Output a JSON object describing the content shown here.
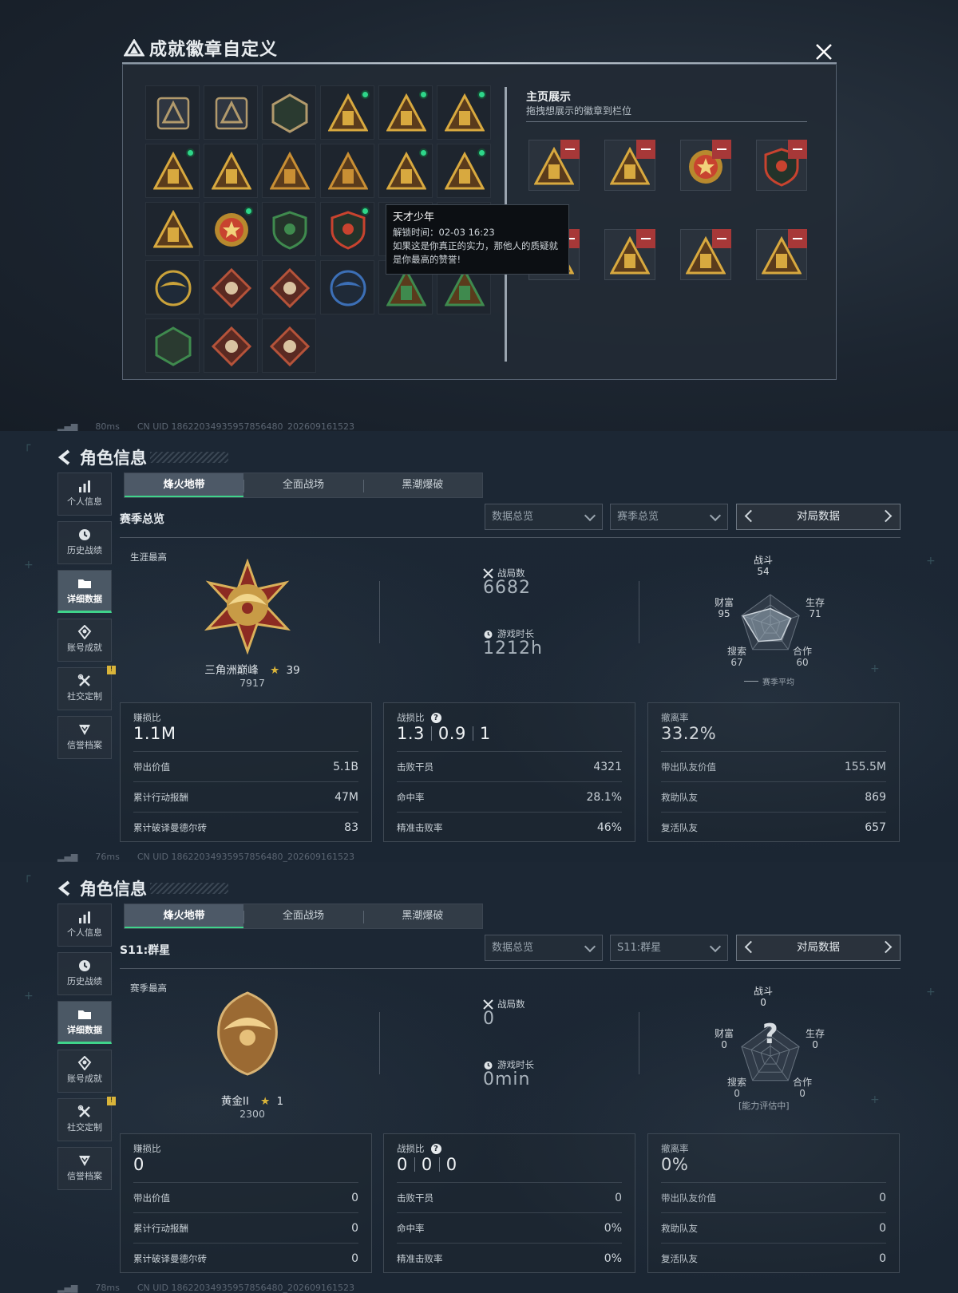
{
  "badge_modal": {
    "title": "成就徽章自定义",
    "showcase_title": "主页展示",
    "showcase_sub": "拖拽想展示的徽章到栏位",
    "tooltip": {
      "name": "天才少年",
      "unlock": "解锁时间：02-03 16:23",
      "desc1": "如果这是你真正的实力，那他人的质疑就",
      "desc2": "是你最高的赞誉!"
    },
    "badges": [
      {
        "icon": "triangle-emblem-icon",
        "color": "#b29a6c",
        "dot": false
      },
      {
        "icon": "helicopter-badge-icon",
        "color": "#b29a6c",
        "dot": false
      },
      {
        "icon": "hex-target-badge-icon",
        "color": "#b29a6c",
        "dot": false
      },
      {
        "icon": "tower-54-badge-icon",
        "color": "#d8a93f",
        "dot": true
      },
      {
        "icon": "figure-55-badge-icon",
        "color": "#d8a93f",
        "dot": true
      },
      {
        "icon": "shield-56-badge-icon",
        "color": "#d8a93f",
        "dot": true
      },
      {
        "icon": "lantern-badge-icon",
        "color": "#d8a93f",
        "dot": true
      },
      {
        "icon": "ship-badge-icon",
        "color": "#d8a93f",
        "dot": false
      },
      {
        "icon": "number-1-badge-icon",
        "color": "#c98f34",
        "dot": false
      },
      {
        "icon": "number-2-badge-icon",
        "color": "#c98f34",
        "dot": false
      },
      {
        "icon": "tower-badge-icon",
        "color": "#d8a93f",
        "dot": true
      },
      {
        "icon": "soldiers-badge-icon",
        "color": "#d8a93f",
        "dot": true
      },
      {
        "icon": "pyramid-badge-icon",
        "color": "#d8a93f",
        "dot": false
      },
      {
        "icon": "star-medal-icon",
        "color": "#c8432f",
        "dot": true
      },
      {
        "icon": "green-shield-badge-icon",
        "color": "#3f8a4e",
        "dot": false
      },
      {
        "icon": "crest-badge-icon",
        "color": "#c8432f",
        "dot": true
      },
      {
        "icon": "blue-wing-badge-icon",
        "color": "#3c6fb6",
        "dot": false
      },
      {
        "icon": "green-wing-badge-icon",
        "color": "#3f8a4e",
        "dot": false
      },
      {
        "icon": "gold-wing-badge-icon",
        "color": "#caa23a",
        "dot": false
      },
      {
        "icon": "wolf-badge-icon",
        "color": "#b5533a",
        "dot": false
      },
      {
        "icon": "wolf-red-badge-icon",
        "color": "#b5533a",
        "dot": false
      },
      {
        "icon": "eagle-coin-badge-icon",
        "color": "#3c6fb6",
        "dot": false
      },
      {
        "icon": "hornet-badge-icon",
        "color": "#3f8a4e",
        "dot": false
      },
      {
        "icon": "hornet-gold-badge-icon",
        "color": "#3f8a4e",
        "dot": false
      },
      {
        "icon": "sword-hex-badge-icon",
        "color": "#3f8a4e",
        "dot": false
      },
      {
        "icon": "dragon-badge-icon",
        "color": "#b5533a",
        "dot": false
      },
      {
        "icon": "runner-badge-icon",
        "color": "#b5533a",
        "dot": false
      }
    ],
    "showcase": [
      {
        "icon": "lantern-badge-icon",
        "color": "#d8a93f"
      },
      {
        "icon": "soldiers-badge-icon",
        "color": "#d8a93f"
      },
      {
        "icon": "star-medal-icon",
        "color": "#c8432f"
      },
      {
        "icon": "crest-badge-icon",
        "color": "#c8432f"
      },
      {
        "icon": "ship-badge-icon",
        "color": "#d8a93f"
      },
      {
        "icon": "figure-55-badge-icon",
        "color": "#d8a93f"
      },
      {
        "icon": "shield-56-badge-icon",
        "color": "#d8a93f"
      },
      {
        "icon": "tower-54-badge-icon",
        "color": "#d8a93f"
      }
    ]
  },
  "net1": {
    "ping": "80ms",
    "uid": "CN UID 18622034935957856480_202609161523"
  },
  "panels": [
    {
      "back_title": "角色信息",
      "nav": [
        "个人信息",
        "历史战绩",
        "详细数据",
        "账号成就",
        "社交定制",
        "信誉档案"
      ],
      "nav_warn": "!",
      "tabs": [
        "烽火地带",
        "全面战场",
        "黑潮爆破"
      ],
      "section": "赛季总览",
      "sel1": "数据总览",
      "sel2": "赛季总览",
      "pager": "对局数据",
      "career_label": "生涯最高",
      "rank_name": "三角洲巅峰",
      "rank_stars": "39",
      "rank_points": "7917",
      "matches_label": "战局数",
      "matches": "6682",
      "time_label": "游戏时长",
      "time": "1212h",
      "radar": {
        "combat_label": "战斗",
        "combat": "54",
        "survival_label": "生存",
        "survival": "71",
        "coop_label": "合作",
        "coop": "60",
        "search_label": "搜索",
        "search": "67",
        "wealth_label": "财富",
        "wealth": "95",
        "values": [
          54,
          71,
          60,
          67,
          95
        ],
        "legend": "赛季平均",
        "note": ""
      },
      "cards": [
        {
          "h": "赚损比",
          "big": [
            "1.1M"
          ],
          "rows": [
            [
              "带出价值",
              "5.1B"
            ],
            [
              "累计行动报酬",
              "47M"
            ],
            [
              "累计破译曼德尔砖",
              "83"
            ]
          ]
        },
        {
          "h": "战损比",
          "q": "?",
          "big": [
            "1.3",
            "0.9",
            "1"
          ],
          "rows": [
            [
              "击败干员",
              "4321"
            ],
            [
              "命中率",
              "28.1%"
            ],
            [
              "精准击败率",
              "46%"
            ]
          ]
        },
        {
          "h": "撤离率",
          "big": [
            "33.2%"
          ],
          "rows": [
            [
              "带出队友价值",
              "155.5M"
            ],
            [
              "救助队友",
              "869"
            ],
            [
              "复活队友",
              "657"
            ]
          ]
        }
      ],
      "net": {
        "ping": "76ms",
        "uid": "CN UID 18622034935957856480_202609161523"
      }
    },
    {
      "back_title": "角色信息",
      "nav": [
        "个人信息",
        "历史战绩",
        "详细数据",
        "账号成就",
        "社交定制",
        "信誉档案"
      ],
      "nav_warn": "!",
      "tabs": [
        "烽火地带",
        "全面战场",
        "黑潮爆破"
      ],
      "section": "S11:群星",
      "sel1": "数据总览",
      "sel2": "S11:群星",
      "pager": "对局数据",
      "career_label": "赛季最高",
      "rank_name": "黄金II",
      "rank_stars": "1",
      "rank_points": "2300",
      "matches_label": "战局数",
      "matches": "0",
      "time_label": "游戏时长",
      "time": "0min",
      "radar": {
        "combat_label": "战斗",
        "combat": "0",
        "survival_label": "生存",
        "survival": "0",
        "coop_label": "合作",
        "coop": "0",
        "search_label": "搜索",
        "search": "0",
        "wealth_label": "财富",
        "wealth": "0",
        "values": [
          0,
          0,
          0,
          0,
          0
        ],
        "legend": "",
        "note": "[能力评估中]",
        "q": "?"
      },
      "cards": [
        {
          "h": "赚损比",
          "big": [
            "0"
          ],
          "rows": [
            [
              "带出价值",
              "0"
            ],
            [
              "累计行动报酬",
              "0"
            ],
            [
              "累计破译曼德尔砖",
              "0"
            ]
          ]
        },
        {
          "h": "战损比",
          "q": "?",
          "big": [
            "0",
            "0",
            "0"
          ],
          "rows": [
            [
              "击败干员",
              "0"
            ],
            [
              "命中率",
              "0%"
            ],
            [
              "精准击败率",
              "0%"
            ]
          ]
        },
        {
          "h": "撤离率",
          "big": [
            "0%"
          ],
          "rows": [
            [
              "带出队友价值",
              "0"
            ],
            [
              "救助队友",
              "0"
            ],
            [
              "复活队友",
              "0"
            ]
          ]
        }
      ],
      "net": {
        "ping": "78ms",
        "uid": "CN UID 18622034935957856480_202609161523"
      }
    }
  ]
}
